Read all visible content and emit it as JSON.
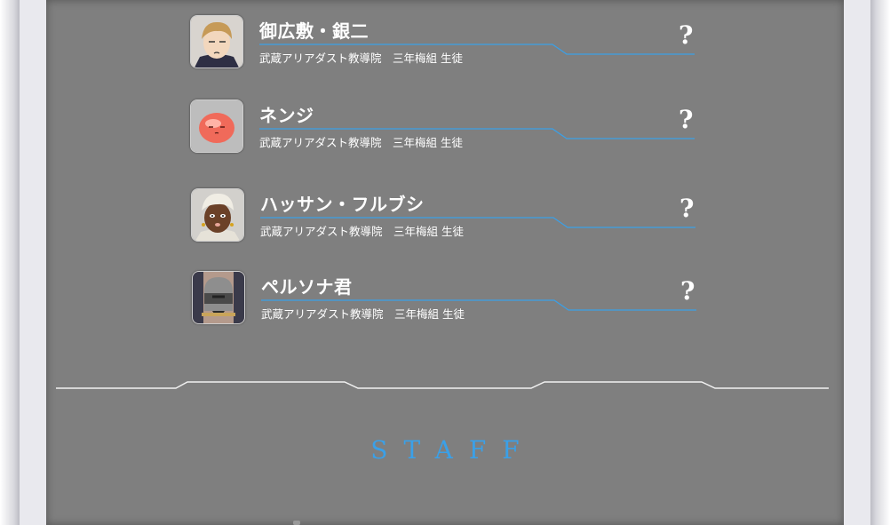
{
  "characters": [
    {
      "name": "御広敷・銀二",
      "affiliation": "武蔵アリアダスト教導院　三年梅組 生徒",
      "detail_mark": "?",
      "avatar_icon": "ohiroshiki-portrait-icon"
    },
    {
      "name": "ネンジ",
      "affiliation": "武蔵アリアダスト教導院　三年梅組 生徒",
      "detail_mark": "?",
      "avatar_icon": "nenji-slime-portrait-icon"
    },
    {
      "name": "ハッサン・フルブシ",
      "affiliation": "武蔵アリアダスト教導院　三年梅組 生徒",
      "detail_mark": "?",
      "avatar_icon": "hassan-portrait-icon"
    },
    {
      "name": "ペルソナ君",
      "affiliation": "武蔵アリアダスト教導院　三年梅組 生徒",
      "detail_mark": "?",
      "avatar_icon": "persona-portrait-icon"
    }
  ],
  "staff_heading": "STAFF",
  "colors": {
    "panel": "#7f7f7f",
    "accent_blue": "#3aa0e8",
    "text": "#ffffff"
  }
}
